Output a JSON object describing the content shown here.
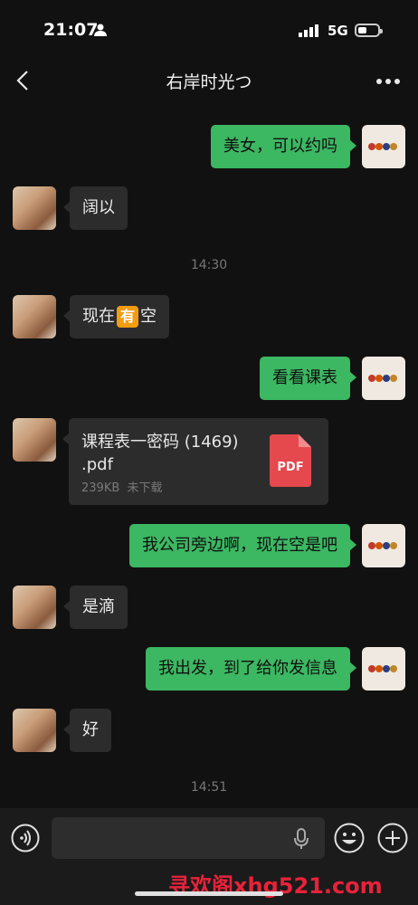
{
  "status": {
    "time": "21:07",
    "network": "5G"
  },
  "header": {
    "title": "右岸时光つ"
  },
  "messages": {
    "m1": "美女，可以约吗",
    "m2": "阔以",
    "ts1": "14:30",
    "m3_before": "现在",
    "m3_emoji": "有",
    "m3_after": "空",
    "m4": "看看课表",
    "file": {
      "name": "课程表一密码 (1469) .pdf",
      "size": "239KB",
      "status": "未下载",
      "badge": "PDF"
    },
    "m5": "我公司旁边啊，现在空是吧",
    "m6": "是滴",
    "m7": "我出发，到了给你发信息",
    "m8": "好",
    "ts2": "14:51"
  },
  "input": {
    "placeholder": ""
  },
  "watermark": "寻欢阁xhg521.com",
  "colors": {
    "sent_bubble": "#3cb762",
    "received_bubble": "#2c2c2c",
    "background": "#111111",
    "pdf_red": "#e5484d"
  },
  "icons": [
    "person-icon",
    "signal-icon",
    "battery-icon",
    "back-icon",
    "more-icon",
    "pdf-icon",
    "voice-icon",
    "mic-icon",
    "emoji-icon",
    "plus-icon"
  ]
}
